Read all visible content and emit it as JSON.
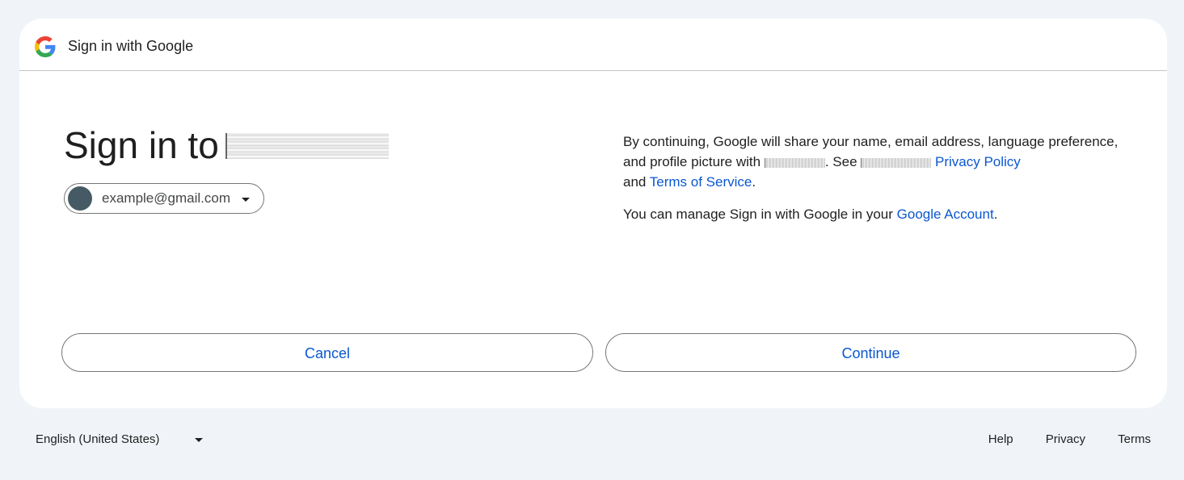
{
  "header": {
    "title": "Sign in with Google",
    "logo_icon": "google-g-logo"
  },
  "main": {
    "title": "Sign in to",
    "account": {
      "email": "example@gmail.com",
      "avatar_color": "#455a64",
      "dropdown_icon": "caret-down-icon"
    }
  },
  "consent": {
    "paragraph1_a": "By continuing, Google will share your name, email address, language preference, and profile picture with ",
    "paragraph1_b": ". See ",
    "privacy_policy_link": "Privacy Policy",
    "paragraph1_c": "and ",
    "terms_link": "Terms of Service",
    "paragraph1_d": ".",
    "paragraph2_a": "You can manage Sign in with Google in your ",
    "google_account_link": "Google Account",
    "paragraph2_b": "."
  },
  "buttons": {
    "cancel_label": "Cancel",
    "continue_label": "Continue"
  },
  "footer": {
    "language": "English (United States)",
    "links": {
      "help": "Help",
      "privacy": "Privacy",
      "terms": "Terms"
    }
  },
  "colors": {
    "background": "#f0f4f9",
    "card": "#ffffff",
    "link": "#0b57d0",
    "text": "#1f1f1f",
    "border": "#747775"
  }
}
